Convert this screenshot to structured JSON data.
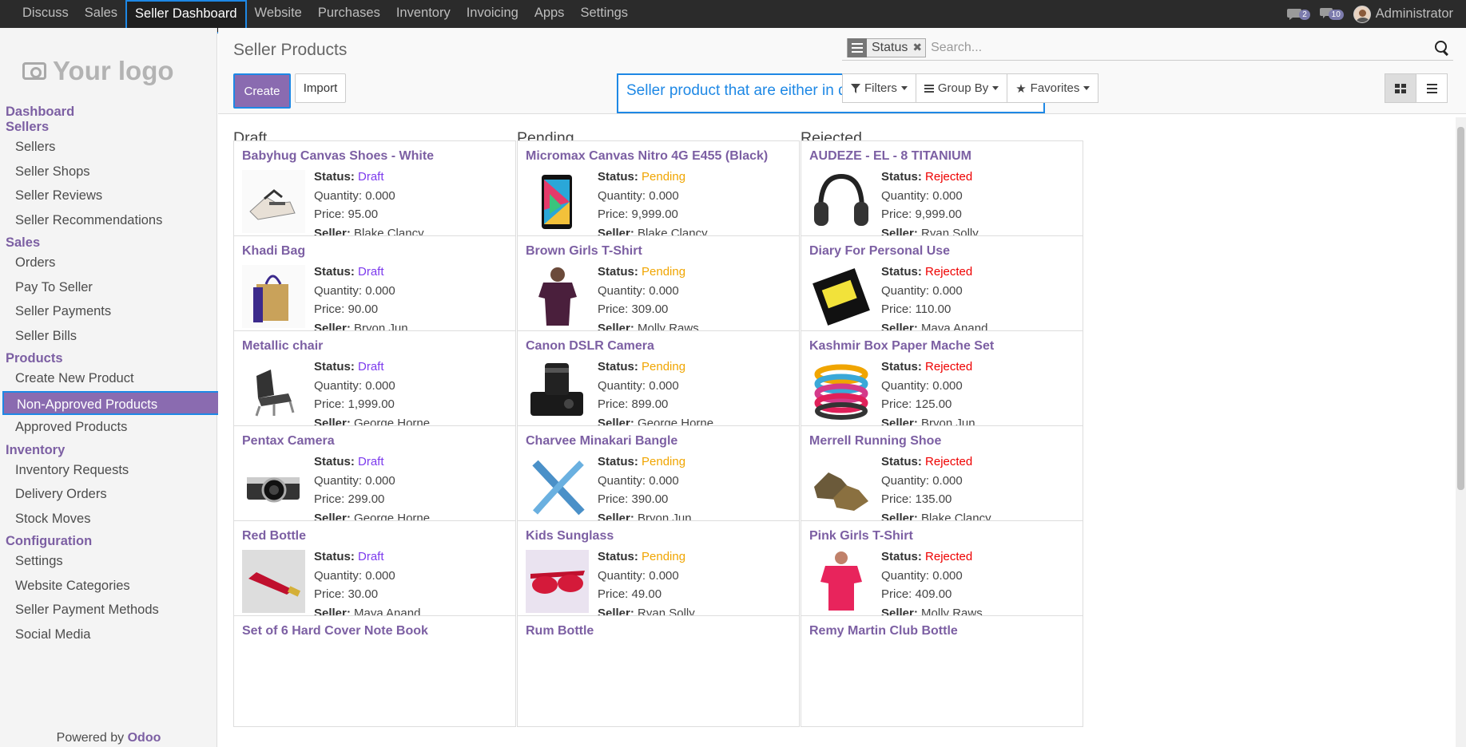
{
  "topbar": {
    "menu": [
      "Discuss",
      "Sales",
      "Seller Dashboard",
      "Website",
      "Purchases",
      "Inventory",
      "Invoicing",
      "Apps",
      "Settings"
    ],
    "active": "Seller Dashboard",
    "chat_count": "2",
    "msg_count": "10",
    "user": "Administrator"
  },
  "sidebar": {
    "logo": "Your logo",
    "sections": [
      {
        "title": "Dashboard",
        "items": []
      },
      {
        "title": "Sellers",
        "items": [
          "Sellers",
          "Seller Shops",
          "Seller Reviews",
          "Seller Recommendations"
        ]
      },
      {
        "title": "Sales",
        "items": [
          "Orders",
          "Pay To Seller",
          "Seller Payments",
          "Seller Bills"
        ]
      },
      {
        "title": "Products",
        "items": [
          "Create New Product",
          "Non-Approved Products",
          "Approved Products"
        ]
      },
      {
        "title": "Inventory",
        "items": [
          "Inventory Requests",
          "Delivery Orders",
          "Stock Moves"
        ]
      },
      {
        "title": "Configuration",
        "items": [
          "Settings",
          "Website Categories",
          "Seller Payment Methods",
          "Social Media"
        ]
      }
    ],
    "active_item": "Non-Approved Products",
    "powered_by": "Powered by",
    "powered_brand": "Odoo"
  },
  "control": {
    "title": "Seller Products",
    "create": "Create",
    "import": "Import",
    "annotation": "Seller product that are either in draft, pending or reject list",
    "facet": "Status",
    "search_placeholder": "Search...",
    "filters": "Filters",
    "group_by": "Group By",
    "favorites": "Favorites"
  },
  "labels": {
    "status": "Status:",
    "quantity": "Quantity:",
    "price": "Price:",
    "seller": "Seller:"
  },
  "columns": [
    {
      "title": "Draft",
      "status": "Draft",
      "cards": [
        {
          "name": "Babyhug Canvas Shoes - White",
          "qty": "0.000",
          "price": "95.00",
          "seller": "Blake Clancy",
          "img": "shoes"
        },
        {
          "name": "Khadi Bag",
          "qty": "0.000",
          "price": "90.00",
          "seller": "Bryon Jun",
          "img": "bag"
        },
        {
          "name": "Metallic chair",
          "qty": "0.000",
          "price": "1,999.00",
          "seller": "George Horne",
          "img": "chair"
        },
        {
          "name": "Pentax Camera",
          "qty": "0.000",
          "price": "299.00",
          "seller": "George Horne",
          "img": "camera"
        },
        {
          "name": "Red Bottle",
          "qty": "0.000",
          "price": "30.00",
          "seller": "Maya Anand",
          "img": "bottle"
        },
        {
          "name": "Set of 6 Hard Cover Note Book",
          "qty": "",
          "price": "",
          "seller": "",
          "img": ""
        }
      ]
    },
    {
      "title": "Pending",
      "status": "Pending",
      "cards": [
        {
          "name": "Micromax Canvas Nitro 4G E455 (Black)",
          "qty": "0.000",
          "price": "9,999.00",
          "seller": "Blake Clancy",
          "img": "phone"
        },
        {
          "name": "Brown Girls T-Shirt",
          "qty": "0.000",
          "price": "309.00",
          "seller": "Molly Raws",
          "img": "tshirt-brown"
        },
        {
          "name": "Canon DSLR Camera",
          "qty": "0.000",
          "price": "899.00",
          "seller": "George Horne",
          "img": "dslr"
        },
        {
          "name": "Charvee Minakari Bangle",
          "qty": "0.000",
          "price": "390.00",
          "seller": "Bryon Jun",
          "img": "bangle"
        },
        {
          "name": "Kids Sunglass",
          "qty": "0.000",
          "price": "49.00",
          "seller": "Ryan Solly",
          "img": "sunglass"
        },
        {
          "name": "Rum Bottle",
          "qty": "",
          "price": "",
          "seller": "",
          "img": ""
        }
      ]
    },
    {
      "title": "Rejected",
      "status": "Rejected",
      "cards": [
        {
          "name": "AUDEZE - EL - 8 TITANIUM",
          "qty": "0.000",
          "price": "9,999.00",
          "seller": "Ryan Solly",
          "img": "headphones"
        },
        {
          "name": "Diary For Personal Use",
          "qty": "0.000",
          "price": "110.00",
          "seller": "Maya Anand",
          "img": "diary"
        },
        {
          "name": "Kashmir Box Paper Mache Set",
          "qty": "0.000",
          "price": "125.00",
          "seller": "Bryon Jun",
          "img": "bangles"
        },
        {
          "name": "Merrell Running Shoe",
          "qty": "0.000",
          "price": "135.00",
          "seller": "Blake Clancy",
          "img": "runshoe"
        },
        {
          "name": "Pink Girls T-Shirt",
          "qty": "0.000",
          "price": "409.00",
          "seller": "Molly Raws",
          "img": "tshirt-pink"
        },
        {
          "name": "Remy Martin Club Bottle",
          "qty": "",
          "price": "",
          "seller": "",
          "img": ""
        }
      ]
    }
  ]
}
